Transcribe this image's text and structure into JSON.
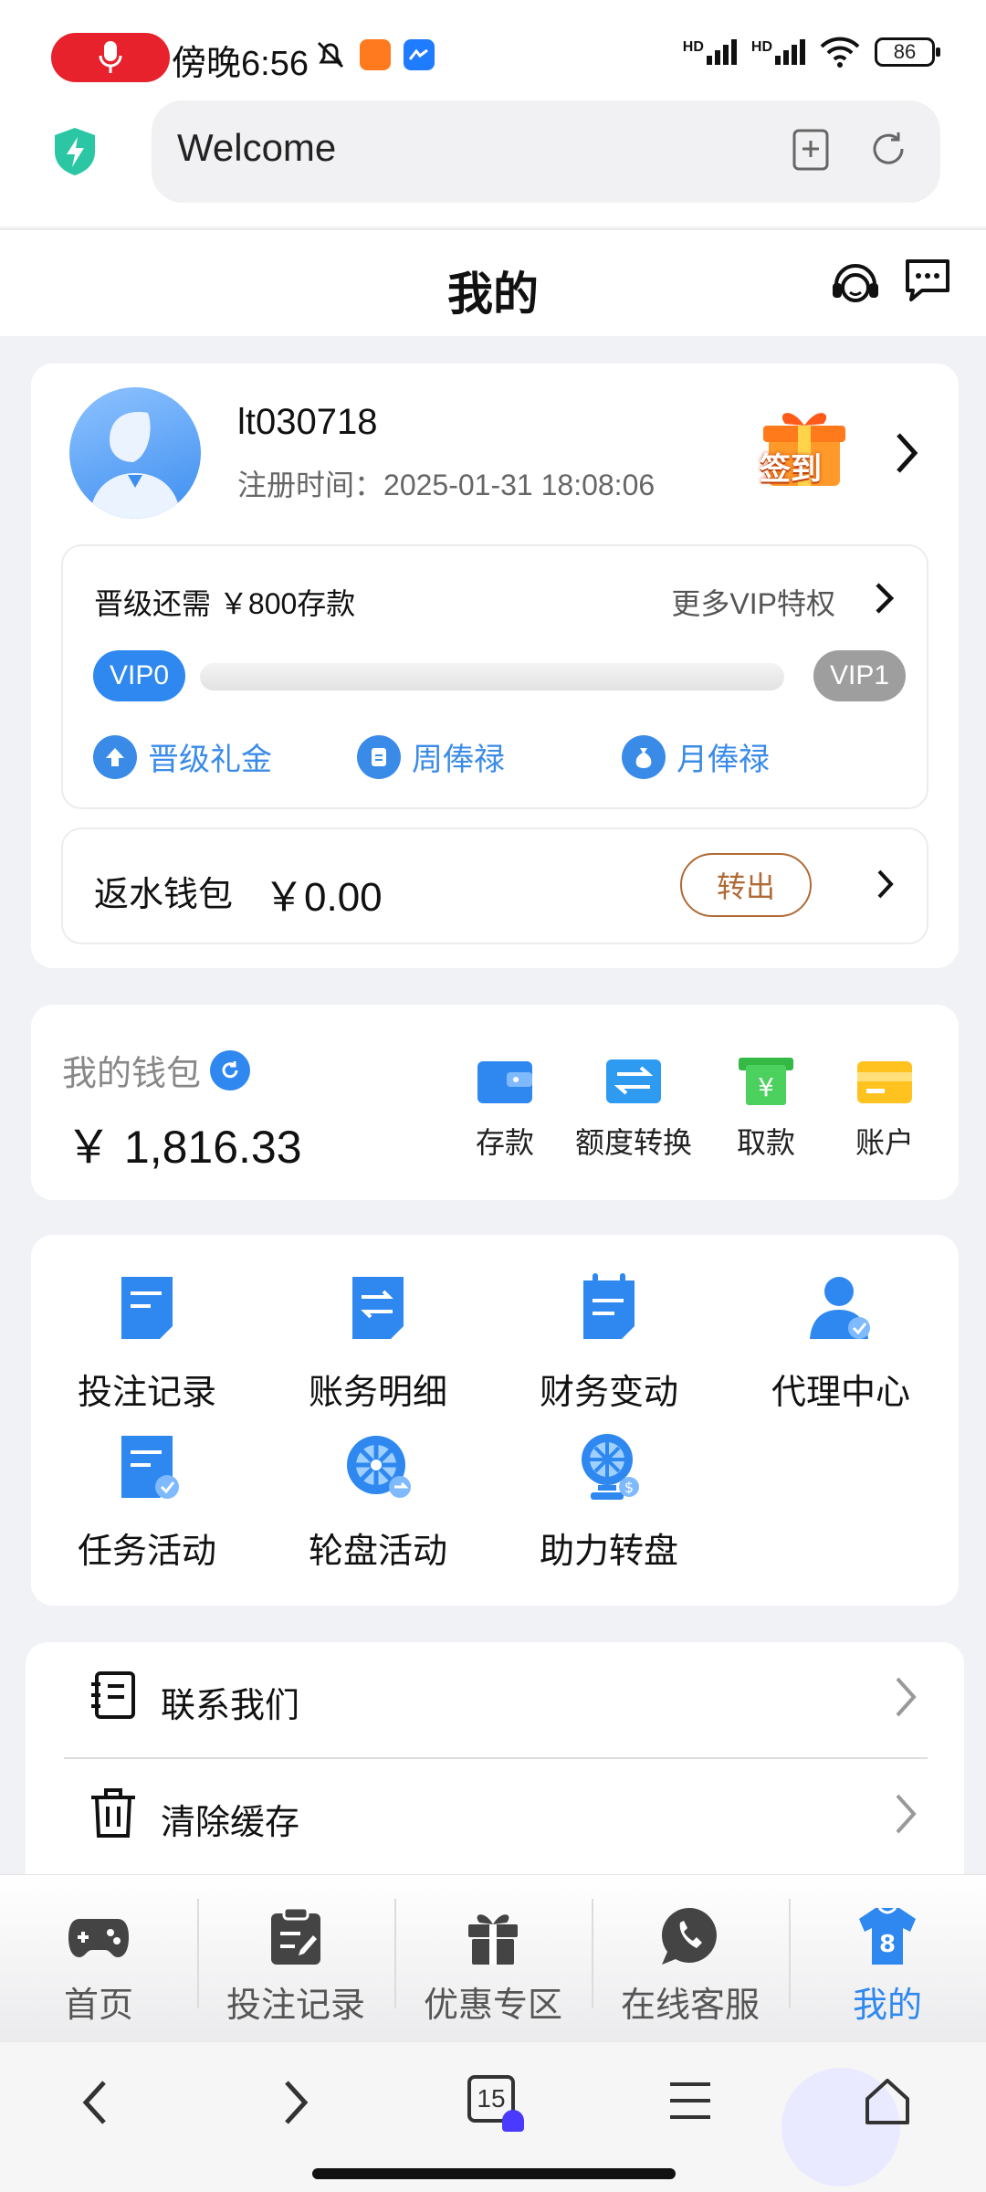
{
  "status_bar": {
    "time": "傍晚6:56",
    "signal_1": "HD",
    "signal_2": "HD",
    "battery": "86"
  },
  "browser": {
    "url_title": "Welcome",
    "tab_count": "15"
  },
  "header": {
    "title": "我的"
  },
  "profile": {
    "username": "lt030718",
    "register_label": "注册时间：",
    "register_time": "2025-01-31 18:08:06",
    "signin_label": "签到"
  },
  "vip": {
    "need_text": "晋级还需 ￥800存款",
    "more_text": "更多VIP特权",
    "current_level": "VIP0",
    "next_level": "VIP1",
    "progress": 0,
    "perks": [
      "晋级礼金",
      "周俸禄",
      "月俸禄"
    ]
  },
  "rebate": {
    "label": "返水钱包",
    "amount": "￥0.00",
    "button": "转出"
  },
  "wallet": {
    "label": "我的钱包",
    "currency": "￥",
    "amount": "1,816.33",
    "actions": [
      "存款",
      "额度转换",
      "取款",
      "账户"
    ]
  },
  "features": {
    "items": [
      "投注记录",
      "账务明细",
      "财务变动",
      "代理中心",
      "任务活动",
      "轮盘活动",
      "助力转盘"
    ]
  },
  "menu": {
    "items": [
      "联系我们",
      "清除缓存"
    ]
  },
  "bottom_nav": {
    "items": [
      "首页",
      "投注记录",
      "优惠专区",
      "在线客服",
      "我的"
    ],
    "active_index": 4
  },
  "colors": {
    "accent": "#2e88f0",
    "transfer": "#b06a35",
    "recording": "#e8222c"
  }
}
